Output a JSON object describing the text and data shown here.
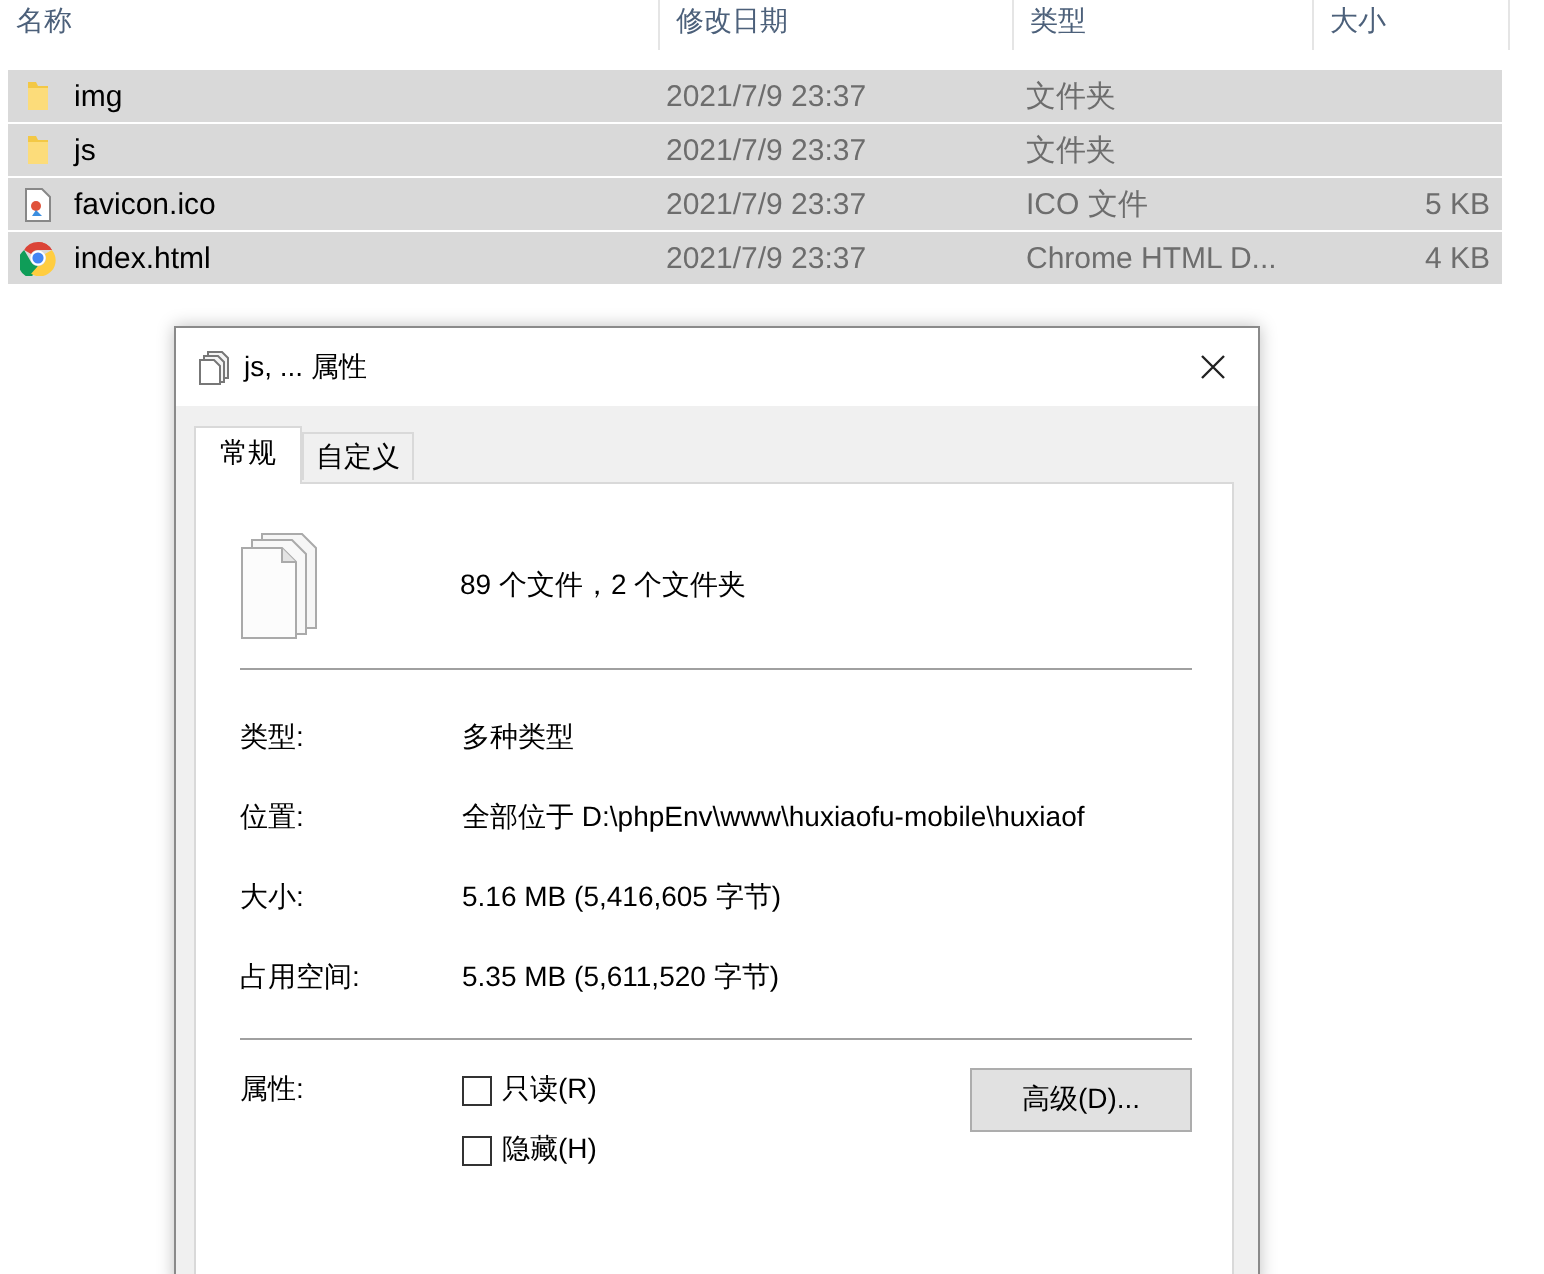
{
  "file_list": {
    "columns": [
      "名称",
      "修改日期",
      "类型",
      "大小"
    ],
    "rows": [
      {
        "name": "img",
        "kind": "folder",
        "modified": "2021/7/9 23:37",
        "type": "文件夹",
        "selected": true
      },
      {
        "name": "js",
        "kind": "folder",
        "modified": "2021/7/9 23:37",
        "type": "文件夹",
        "selected": true
      },
      {
        "name": "favicon.ico",
        "kind": "image",
        "modified": "2021/7/9 23:37",
        "type": "ICO 文件",
        "size": "5 KB",
        "selected": true
      },
      {
        "name": "index.html",
        "kind": "browser",
        "modified": "2021/7/9 23:37",
        "type": "Chrome HTML D...",
        "size": "4 KB",
        "selected": true
      }
    ]
  },
  "dialog": {
    "title": "js, ... 属性",
    "tabs": [
      {
        "label": "常规",
        "selected": true
      },
      {
        "label": "自定义",
        "selected": false
      }
    ],
    "summary": "89 个文件，2 个文件夹",
    "properties": [
      {
        "label": "类型:",
        "value": "多种类型"
      },
      {
        "label": "位置:",
        "value": "全部位于 D:\\phpEnv\\www\\huxiaofu-mobile\\huxiaof"
      },
      {
        "label": "大小:",
        "value": "5.16 MB (5,416,605 字节)"
      },
      {
        "label": "占用空间:",
        "value": "5.35 MB (5,611,520 字节)"
      }
    ],
    "attributes_label": "属性:",
    "attributes": [
      {
        "label": "只读(R)",
        "checked": false
      },
      {
        "label": "隐藏(H)",
        "checked": false
      }
    ],
    "advanced_button": "高级(D)..."
  }
}
